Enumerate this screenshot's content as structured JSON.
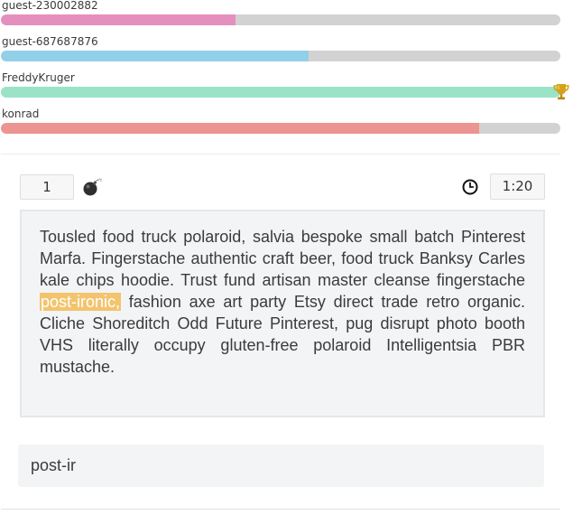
{
  "racers": [
    {
      "name": "guest-230002882",
      "progress": 0.42,
      "color": "#e58fbe",
      "leader": false
    },
    {
      "name": "guest-687687876",
      "progress": 0.55,
      "color": "#92cfe8",
      "leader": false
    },
    {
      "name": "FreddyKruger",
      "progress": 1.0,
      "color": "#9be3c7",
      "leader": true
    },
    {
      "name": "konrad",
      "progress": 0.855,
      "color": "#ec9491",
      "leader": false
    }
  ],
  "game": {
    "word_count": "1",
    "timer": "1:20",
    "passage_before": "Tousled food truck polaroid, salvia bespoke small batch Pinterest Marfa. Fingerstache authentic craft beer, food truck Banksy Carles kale chips hoodie. Trust fund artisan master cleanse fingerstache ",
    "passage_current": "post-ironic,",
    "passage_after": " fashion axe art party Etsy direct trade retro organic. Cliche Shoreditch Odd Future Pinterest, pug disrupt photo booth VHS literally occupy gluten-free polaroid Intelligentsia PBR mustache.",
    "typed_input": "post-ir"
  },
  "icons": {
    "bomb": "bomb-icon",
    "clock": "clock-icon",
    "trophy": "trophy-icon"
  }
}
